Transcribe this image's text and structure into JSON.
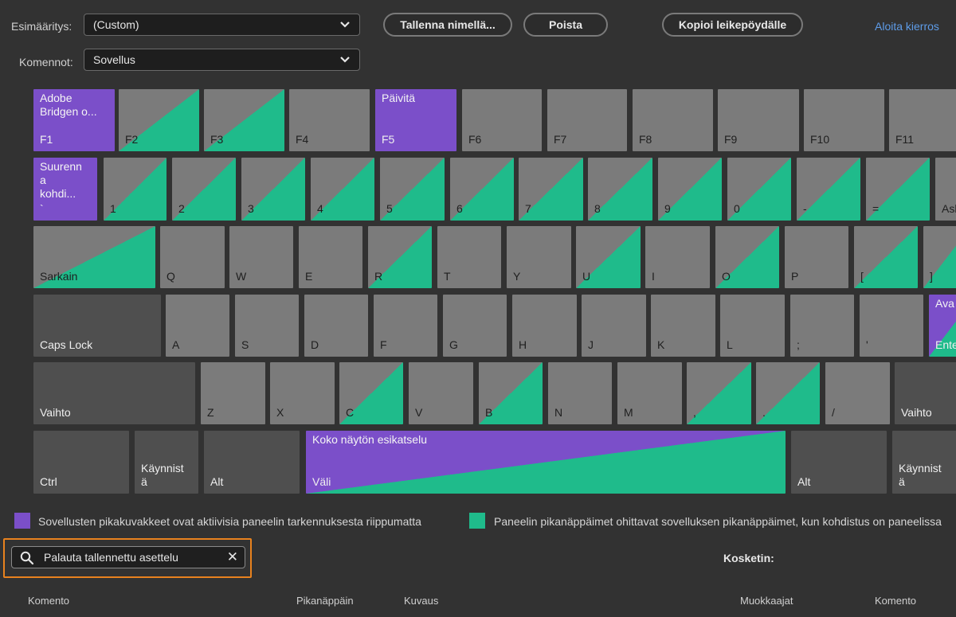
{
  "toolbar": {
    "preset_label": "Esimääritys:",
    "preset_value": "(Custom)",
    "commands_label": "Komennot:",
    "commands_value": "Sovellus",
    "save_as_label": "Tallenna nimellä...",
    "delete_label": "Poista",
    "copy_label": "Kopioi leikepöydälle",
    "start_tour_label": "Aloita kierros"
  },
  "keyboard": {
    "row_fn": [
      {
        "key": "F1",
        "command": "Adobe\nBridgen o...",
        "style": "purple"
      },
      {
        "key": "F2",
        "style": "split"
      },
      {
        "key": "F3",
        "style": "split"
      },
      {
        "key": "F4",
        "style": "plain"
      },
      {
        "key": "F5",
        "command": "Päivitä",
        "style": "purple"
      },
      {
        "key": "F6",
        "style": "plain"
      },
      {
        "key": "F7",
        "style": "plain"
      },
      {
        "key": "F8",
        "style": "plain"
      },
      {
        "key": "F9",
        "style": "plain"
      },
      {
        "key": "F10",
        "style": "plain"
      },
      {
        "key": "F11",
        "style": "plain"
      }
    ],
    "row_num": [
      {
        "key": "`",
        "command": "Suurenn\na\nkohdi...",
        "style": "purple"
      },
      {
        "key": "1",
        "style": "split"
      },
      {
        "key": "2",
        "style": "split"
      },
      {
        "key": "3",
        "style": "split"
      },
      {
        "key": "4",
        "style": "split"
      },
      {
        "key": "5",
        "style": "split"
      },
      {
        "key": "6",
        "style": "split"
      },
      {
        "key": "7",
        "style": "split"
      },
      {
        "key": "8",
        "style": "split"
      },
      {
        "key": "9",
        "style": "split"
      },
      {
        "key": "0",
        "style": "split"
      },
      {
        "key": "-",
        "style": "split"
      },
      {
        "key": "=",
        "style": "split"
      },
      {
        "key": "Askelpalautin",
        "style": "plain"
      }
    ],
    "row_q": [
      {
        "key": "Sarkain",
        "style": "split"
      },
      {
        "key": "Q",
        "style": "plain"
      },
      {
        "key": "W",
        "style": "plain"
      },
      {
        "key": "E",
        "style": "plain"
      },
      {
        "key": "R",
        "style": "split"
      },
      {
        "key": "T",
        "style": "plain"
      },
      {
        "key": "Y",
        "style": "plain"
      },
      {
        "key": "U",
        "style": "split"
      },
      {
        "key": "I",
        "style": "plain"
      },
      {
        "key": "O",
        "style": "split"
      },
      {
        "key": "P",
        "style": "plain"
      },
      {
        "key": "[",
        "style": "split"
      },
      {
        "key": "]",
        "style": "split"
      }
    ],
    "row_a": [
      {
        "key": "Caps Lock",
        "style": "dark"
      },
      {
        "key": "A",
        "style": "plain"
      },
      {
        "key": "S",
        "style": "plain"
      },
      {
        "key": "D",
        "style": "plain"
      },
      {
        "key": "F",
        "style": "plain"
      },
      {
        "key": "G",
        "style": "plain"
      },
      {
        "key": "H",
        "style": "plain"
      },
      {
        "key": "J",
        "style": "plain"
      },
      {
        "key": "K",
        "style": "plain"
      },
      {
        "key": "L",
        "style": "plain"
      },
      {
        "key": ";",
        "style": "plain"
      },
      {
        "key": "'",
        "style": "plain"
      },
      {
        "key": "Enter",
        "command": "Ava",
        "style": "psplit"
      }
    ],
    "row_z": [
      {
        "key": "Vaihto",
        "style": "dark"
      },
      {
        "key": "Z",
        "style": "plain"
      },
      {
        "key": "X",
        "style": "plain"
      },
      {
        "key": "C",
        "style": "split"
      },
      {
        "key": "V",
        "style": "plain"
      },
      {
        "key": "B",
        "style": "split"
      },
      {
        "key": "N",
        "style": "plain"
      },
      {
        "key": "M",
        "style": "plain"
      },
      {
        "key": ",",
        "style": "split"
      },
      {
        "key": ".",
        "style": "split"
      },
      {
        "key": "/",
        "style": "plain"
      },
      {
        "key": "Vaihto",
        "style": "dark"
      }
    ],
    "row_bottom": [
      {
        "key": "Ctrl",
        "style": "dark"
      },
      {
        "key": "Käynnist\nä",
        "style": "dark"
      },
      {
        "key": "Alt",
        "style": "dark"
      },
      {
        "key": "Väli",
        "command": "Koko näytön esikatselu",
        "style": "psplit"
      },
      {
        "key": "Alt",
        "style": "dark"
      },
      {
        "key": "Käynnist\nä",
        "style": "dark"
      }
    ]
  },
  "legend": {
    "app_text": "Sovellusten pikakuvakkeet ovat aktiivisia paneelin tarkennuksesta riippumatta",
    "panel_text": "Paneelin pikanäppäimet ohittavat sovelluksen pikanäppäimet, kun kohdistus on paneelissa",
    "app_color": "#7b4fc9",
    "panel_color": "#1fbb8b"
  },
  "search": {
    "value": "Palauta tallennettu asettelu",
    "icon": "search-icon",
    "clear_icon": "close-icon"
  },
  "details": {
    "modifier_label": "Kosketin:"
  },
  "table": {
    "headers": [
      "Komento",
      "Pikanäppäin",
      "Kuvaus"
    ],
    "right_headers": [
      "Muokkaajat",
      "Komento"
    ]
  },
  "colors": {
    "background": "#323232",
    "key": "#7b7b7b",
    "key_modifier": "#4f4f4f",
    "highlight": "#e8821e",
    "link": "#5e9ce8"
  }
}
